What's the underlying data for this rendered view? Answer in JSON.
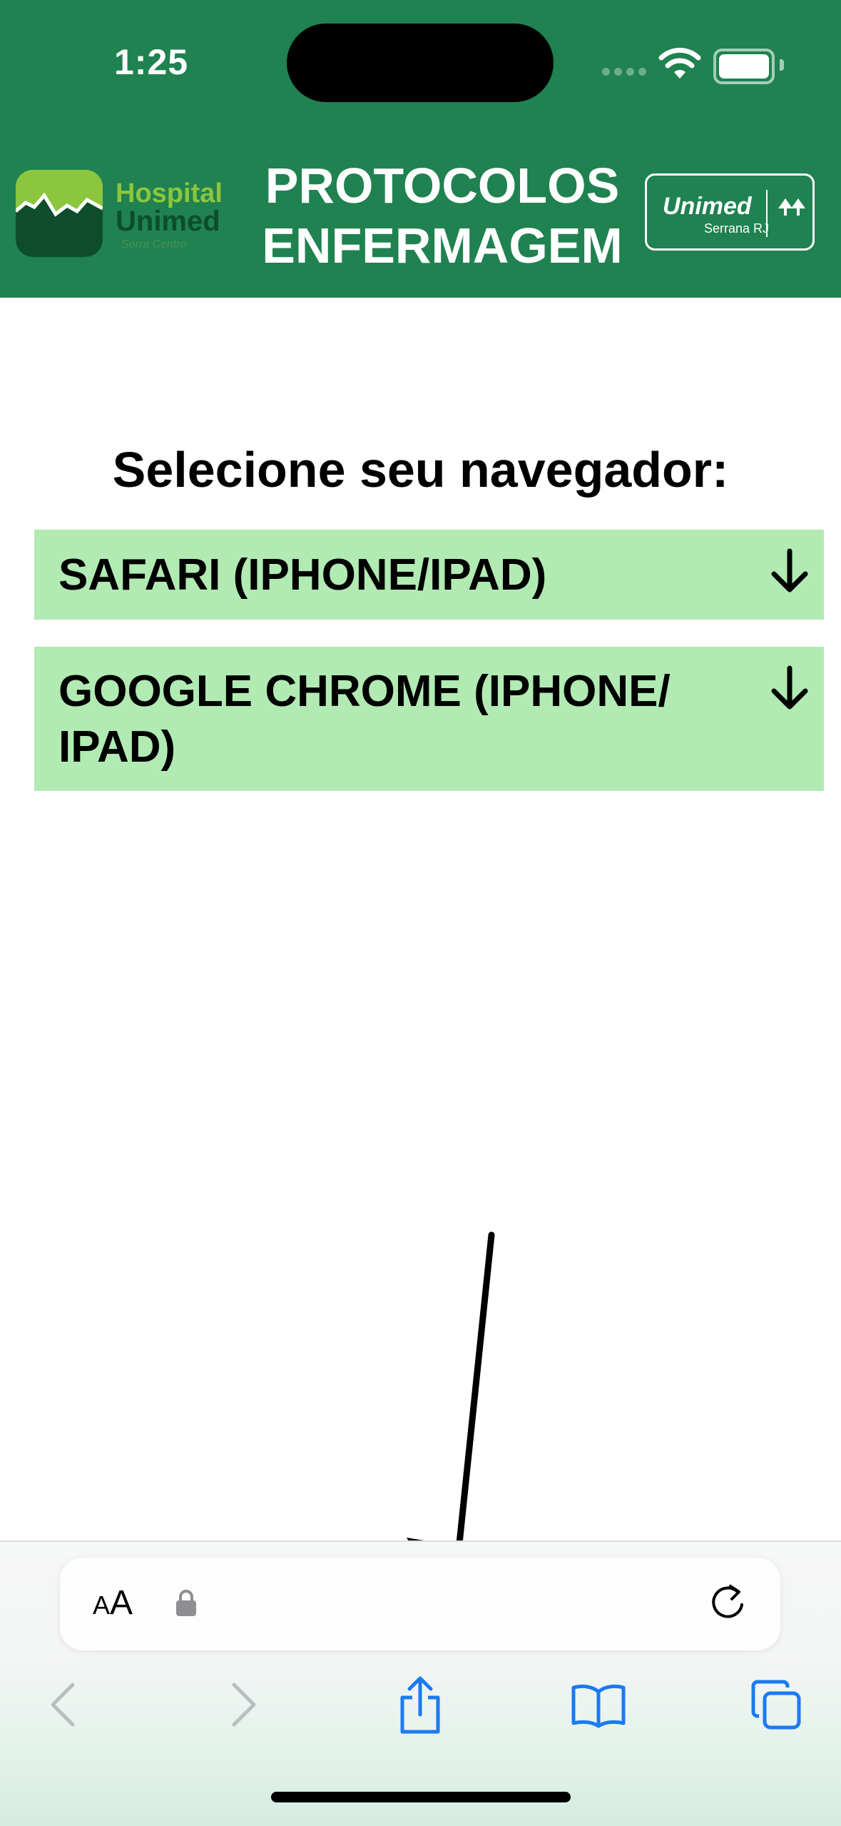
{
  "status_bar": {
    "time": "1:25"
  },
  "header": {
    "logo_left": {
      "line1": "Hospital",
      "line2": "Unimed",
      "line3": "Serra Centro"
    },
    "title_line1": "PROTOCOLOS",
    "title_line2": "ENFERMAGEM",
    "logo_right": {
      "brand": "Unimed",
      "region": "Serrana RJ"
    }
  },
  "main": {
    "prompt": "Selecione seu navegador:",
    "options": [
      {
        "label": "SAFARI (IPHONE/IPAD)"
      },
      {
        "label": "GOOGLE CHROME (IPHONE/ IPAD)"
      }
    ]
  },
  "browser": {
    "text_size_label_small": "A",
    "text_size_label_large": "A",
    "icons": [
      "lock-icon",
      "reload-icon",
      "back-icon",
      "forward-icon",
      "share-icon",
      "bookmarks-icon",
      "tabs-icon"
    ]
  },
  "colors": {
    "header_green": "#1f8250",
    "option_bg": "#b1ebb3",
    "ios_blue": "#1a7bf2"
  }
}
